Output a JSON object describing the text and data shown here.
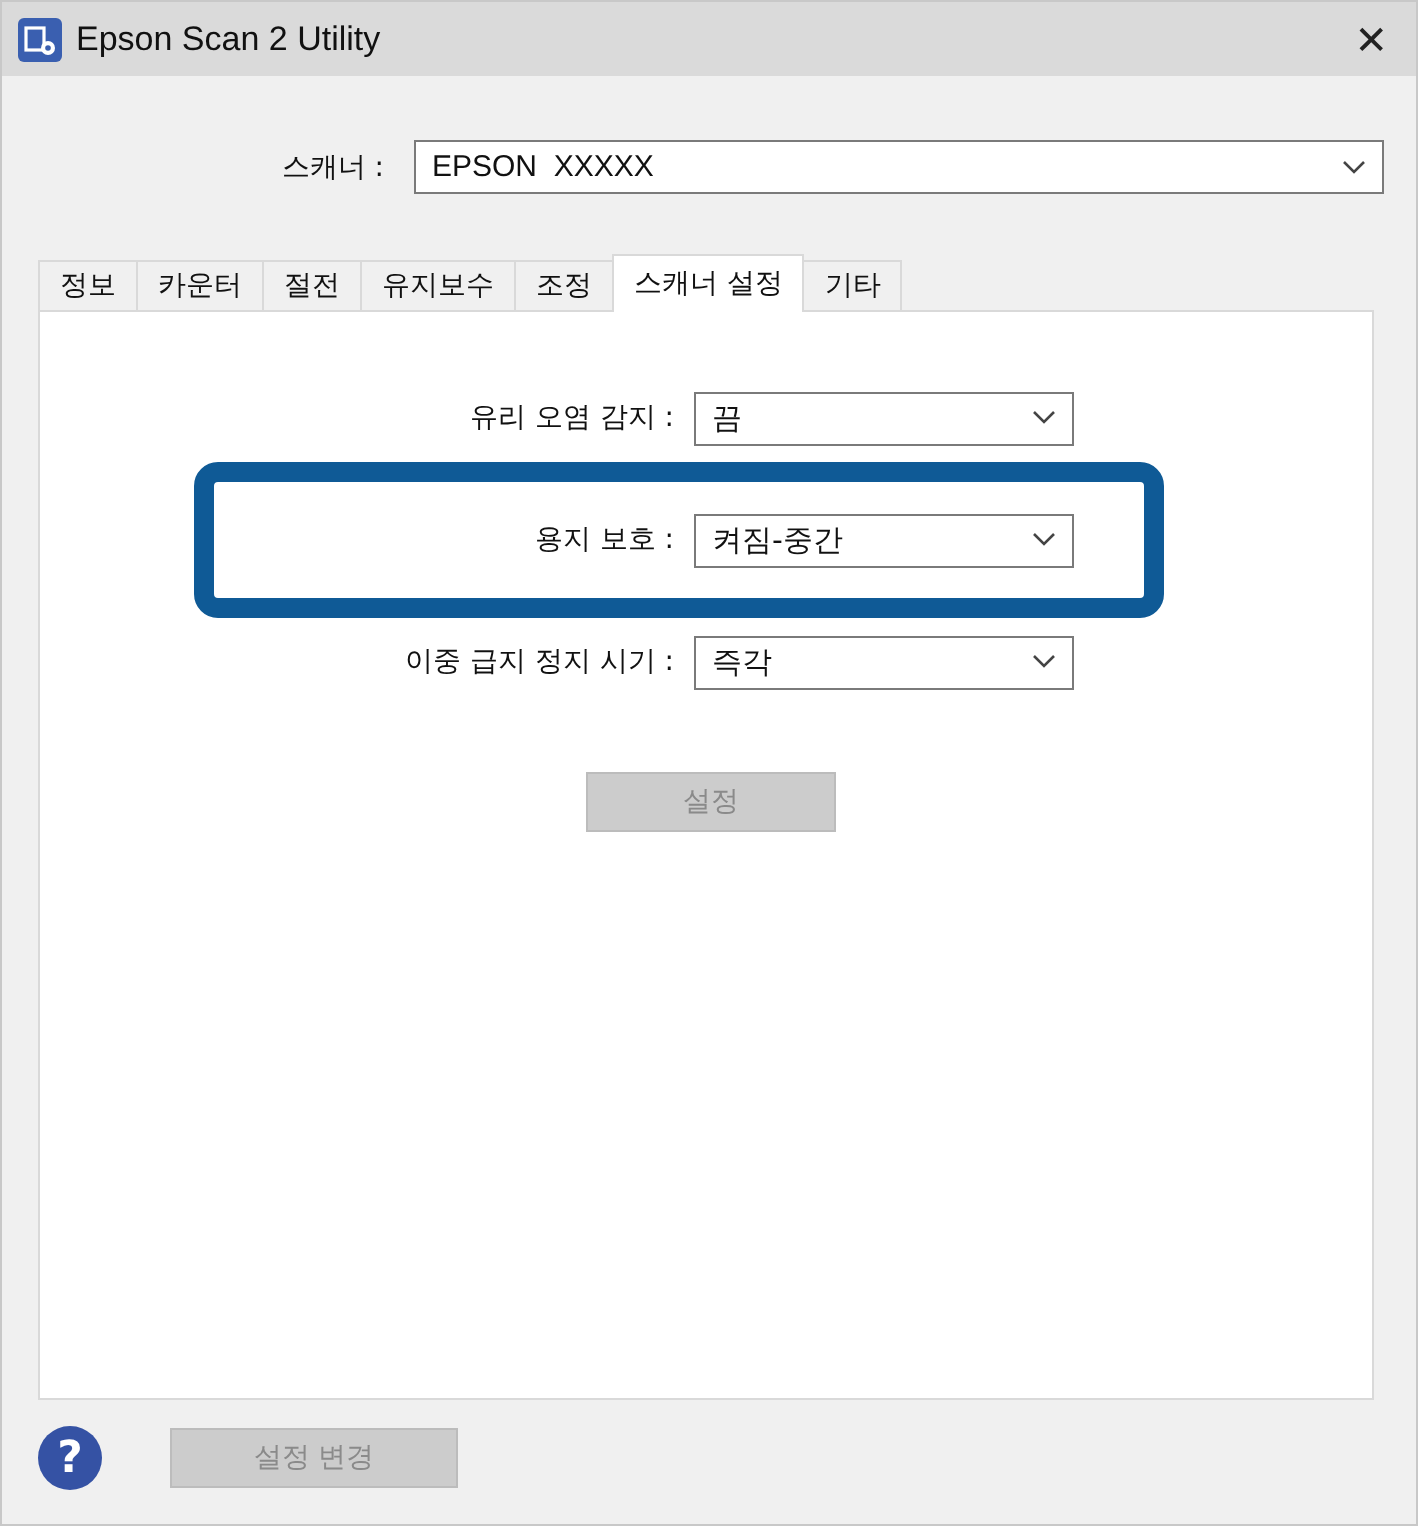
{
  "window": {
    "title": "Epson Scan 2 Utility",
    "close": "✕"
  },
  "scanner": {
    "label": "스캐너 :",
    "value": "EPSON  XXXXX"
  },
  "tabs": [
    {
      "label": "정보",
      "selected": false
    },
    {
      "label": "카운터",
      "selected": false
    },
    {
      "label": "절전",
      "selected": false
    },
    {
      "label": "유지보수",
      "selected": false
    },
    {
      "label": "조정",
      "selected": false
    },
    {
      "label": "스캐너 설정",
      "selected": true
    },
    {
      "label": "기타",
      "selected": false
    }
  ],
  "settings": [
    {
      "label": "유리 오염 감지 :",
      "value": "끔",
      "highlighted": false
    },
    {
      "label": "용지 보호 :",
      "value": "켜짐-중간",
      "highlighted": true
    },
    {
      "label": "이중 급지 정지 시기 :",
      "value": "즉각",
      "highlighted": false
    }
  ],
  "set_button": {
    "label": "설정",
    "disabled": true
  },
  "footer": {
    "help": "?",
    "change_button": {
      "label": "설정 변경",
      "disabled": true
    }
  }
}
